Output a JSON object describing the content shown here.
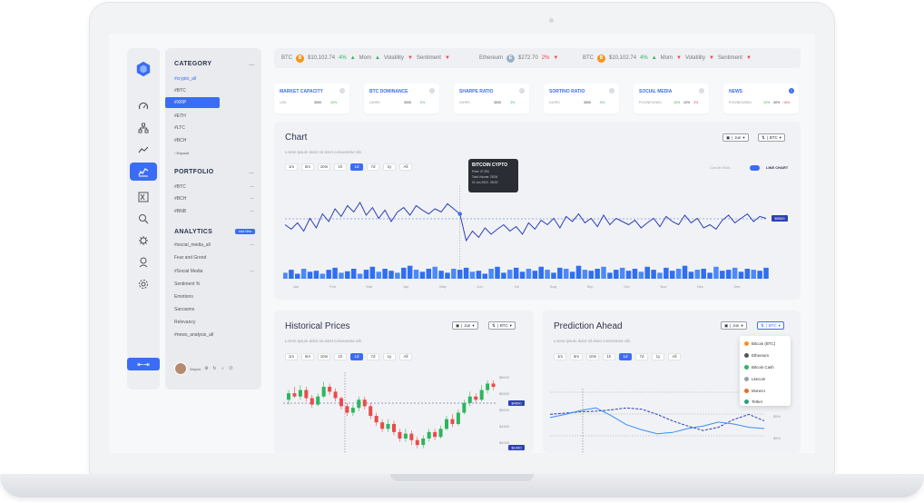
{
  "ticker": [
    {
      "symbol": "BTC",
      "coin_letter": "B",
      "coin_color": "#f7931a",
      "price": "$10,102.74",
      "change": "4%",
      "mom": "Mom",
      "mom_dir": "up",
      "volatility": "Volatility",
      "vol_dir": "down",
      "sentiment": "Sentiment",
      "sent_dir": "down"
    },
    {
      "symbol": "Ethereum",
      "coin_letter": "E",
      "coin_color": "#9ab0c8",
      "price": "$272.70",
      "change": "2%",
      "change_dir": "down"
    },
    {
      "symbol": "BTC",
      "coin_letter": "B",
      "coin_color": "#f7931a",
      "price": "$10,102.74",
      "change": "4%",
      "mom": "Mom",
      "volatility": "Volatility",
      "sentiment": "Sentiment"
    }
  ],
  "metrics": [
    {
      "title": "MARKET CAPACITY",
      "sub": "USD",
      "value": "3000",
      "pct": "10%",
      "pct_dir": "up"
    },
    {
      "title": "BTC DOMINANCE",
      "sub": "24HRS",
      "value": "3000",
      "pct": "5%",
      "pct_dir": "up"
    },
    {
      "title": "SHARPE RATIO",
      "sub": "24HRS",
      "value": "3000",
      "pct": "3%",
      "pct_dir": "up"
    },
    {
      "title": "SORTINO RATIO",
      "sub": "24HRS",
      "value": "3000",
      "pct": "5%",
      "pct_dir": "up"
    },
    {
      "title": "SOCIAL MEDIA",
      "sub": "POS/NEG/NEU",
      "v1": "15%",
      "v2": "10%",
      "v3": "3%"
    },
    {
      "title": "NEWS",
      "sub": "POS/NEG/NEU",
      "v1": "10%",
      "v2": "40%",
      "v3": "16%"
    }
  ],
  "sidebar": {
    "category_title": "CATEGORY",
    "category_items": [
      "#crypto_all",
      "#BTC",
      "#XRP",
      "#ETH",
      "#LTC",
      "#BCH",
      "Expand"
    ],
    "portfolio_title": "PORTFOLIO",
    "portfolio_items": [
      "#BTC",
      "#BCH",
      "#BNB"
    ],
    "analytics_title": "ANALYTICS",
    "analytics_badge": "Add New",
    "analytics_items": [
      "#social_media_all",
      "Fear and Greed",
      "#Social Media",
      "Sentiment %",
      "Emotions",
      "Sarcasms",
      "Relevancy",
      "#news_analysis_all"
    ],
    "profile_name": "Wayne"
  },
  "chart_panel": {
    "title": "Chart",
    "subtitle": "Lorem ipsum dolor sit amet consectetur elit.",
    "timeframes": [
      "1m",
      "5m",
      "10m",
      "1h",
      "1d",
      "7d",
      "1y",
      "All"
    ],
    "active_tf": "1d",
    "dd_period": "Jun",
    "dd_coin": "BTC",
    "toggle_left": "Candle Stick",
    "toggle_right": "LINE CHART",
    "tooltip_title": "BITCOIN CYPTO",
    "tooltip_lines": [
      "Price: 37.294",
      "Total Volume: 257M",
      "01 Jun 2019 - 08:00"
    ],
    "price_tag": "$9500"
  },
  "historical_panel": {
    "title": "Historical Prices",
    "subtitle": "Lorem ipsum dolor sit amet consectetur elit.",
    "timeframes": [
      "1m",
      "5m",
      "10m",
      "1h",
      "1d",
      "7d",
      "1y",
      "All"
    ],
    "active_tf": "1d",
    "dd_period": "Jun",
    "dd_coin": "BTC",
    "y_labels": [
      "$6000",
      "$5500",
      "$5000",
      "$4500",
      "$4000"
    ],
    "price_tags": [
      "$4500",
      "$1400"
    ]
  },
  "prediction_panel": {
    "title": "Prediction Ahead",
    "subtitle": "Lorem ipsum dolor sit amet consectetur elit.",
    "timeframes": [
      "1m",
      "5m",
      "10m",
      "1h",
      "1d",
      "7d",
      "1y",
      "All"
    ],
    "active_tf": "1d",
    "dd_period": "Jun",
    "dd_coin": "BTC",
    "y_labels": [
      "$5%",
      "$5%",
      "$5%"
    ],
    "coin_menu": [
      {
        "name": "Bitcoin (BTC)",
        "color": "#f7931a"
      },
      {
        "name": "Ethereum",
        "color": "#555"
      },
      {
        "name": "Bitcoin Cash",
        "color": "#2db55d"
      },
      {
        "name": "Litecoin",
        "color": "#9aa0ab"
      },
      {
        "name": "Monero",
        "color": "#f26822"
      },
      {
        "name": "Tether",
        "color": "#26a17b"
      }
    ]
  },
  "chart_data": [
    {
      "type": "line",
      "x": [
        "Jan",
        "Feb",
        "Mar",
        "Apr",
        "May",
        "Jun",
        "Jul",
        "Aug",
        "Sep",
        "Oct",
        "Nov",
        "Dec",
        "Dec"
      ],
      "series": [
        {
          "values": [
            45,
            38,
            48,
            35,
            55,
            40,
            62,
            50,
            70,
            58,
            75,
            65,
            80,
            60,
            72,
            55,
            68,
            50,
            65,
            72,
            60,
            75,
            68,
            62,
            70,
            65,
            78,
            70,
            62,
            20,
            35,
            25,
            40,
            30,
            38,
            45,
            35,
            42,
            30,
            48,
            38,
            52,
            45,
            55,
            40,
            58,
            50,
            62,
            48,
            55,
            42,
            60,
            45,
            55,
            50,
            45,
            52,
            40,
            48,
            55,
            42,
            58,
            50,
            45,
            60,
            48,
            55,
            40,
            45,
            38,
            52,
            60,
            48,
            55,
            62,
            50,
            58,
            55
          ]
        },
        {
          "values": [
            12,
            18,
            10,
            20,
            14,
            16,
            10,
            18,
            22,
            12,
            15,
            20,
            10,
            18,
            24,
            14,
            20,
            16,
            12,
            22,
            26,
            18,
            14,
            20,
            24,
            16,
            12,
            20,
            18,
            22,
            14,
            16,
            10,
            20,
            24,
            12,
            18,
            22,
            14,
            20,
            16,
            24,
            18,
            12,
            22,
            20,
            14,
            26,
            18,
            16,
            20,
            24,
            12,
            18,
            22,
            16,
            20,
            14,
            24,
            18,
            12,
            22,
            16,
            20,
            26,
            14,
            18,
            20,
            12,
            24,
            16,
            18,
            22,
            14,
            20,
            18,
            16,
            22
          ]
        }
      ]
    },
    {
      "type": "bar",
      "title": "",
      "candles": [
        [
          4680,
          4720,
          4650,
          4740
        ],
        [
          4720,
          4700,
          4690,
          4760
        ],
        [
          4700,
          4740,
          4680,
          4770
        ],
        [
          4740,
          4690,
          4670,
          4760
        ],
        [
          4690,
          4650,
          4630,
          4710
        ],
        [
          4650,
          4700,
          4640,
          4720
        ],
        [
          4700,
          4760,
          4690,
          4790
        ],
        [
          4760,
          4730,
          4710,
          4780
        ],
        [
          4730,
          4690,
          4670,
          4750
        ],
        [
          4690,
          4640,
          4620,
          4700
        ],
        [
          4640,
          4600,
          4580,
          4660
        ],
        [
          4600,
          4630,
          4580,
          4650
        ],
        [
          4630,
          4680,
          4610,
          4700
        ],
        [
          4680,
          4640,
          4620,
          4700
        ],
        [
          4640,
          4580,
          4560,
          4660
        ],
        [
          4580,
          4540,
          4520,
          4600
        ],
        [
          4540,
          4500,
          4480,
          4560
        ],
        [
          4500,
          4530,
          4480,
          4560
        ],
        [
          4530,
          4480,
          4460,
          4550
        ],
        [
          4480,
          4440,
          4420,
          4500
        ],
        [
          4440,
          4470,
          4420,
          4500
        ],
        [
          4470,
          4430,
          4400,
          4490
        ],
        [
          4430,
          4400,
          4380,
          4450
        ],
        [
          4400,
          4440,
          4380,
          4460
        ],
        [
          4440,
          4480,
          4420,
          4500
        ],
        [
          4480,
          4450,
          4430,
          4500
        ],
        [
          4450,
          4500,
          4440,
          4520
        ],
        [
          4500,
          4560,
          4490,
          4580
        ],
        [
          4560,
          4530,
          4510,
          4590
        ],
        [
          4530,
          4600,
          4520,
          4620
        ],
        [
          4600,
          4660,
          4590,
          4680
        ],
        [
          4660,
          4700,
          4640,
          4730
        ],
        [
          4700,
          4680,
          4660,
          4720
        ],
        [
          4680,
          4740,
          4670,
          4770
        ],
        [
          4740,
          4780,
          4720,
          4800
        ],
        [
          4780,
          4760,
          4740,
          4800
        ]
      ]
    },
    {
      "type": "line",
      "series": [
        {
          "values": [
            60,
            62,
            64,
            65,
            67,
            70,
            68,
            60,
            50,
            42,
            35,
            40,
            52,
            60,
            50
          ]
        },
        {
          "values": [
            55,
            60,
            66,
            70,
            58,
            44,
            36,
            30,
            32,
            38,
            42,
            48,
            45,
            40,
            38
          ]
        }
      ]
    }
  ]
}
